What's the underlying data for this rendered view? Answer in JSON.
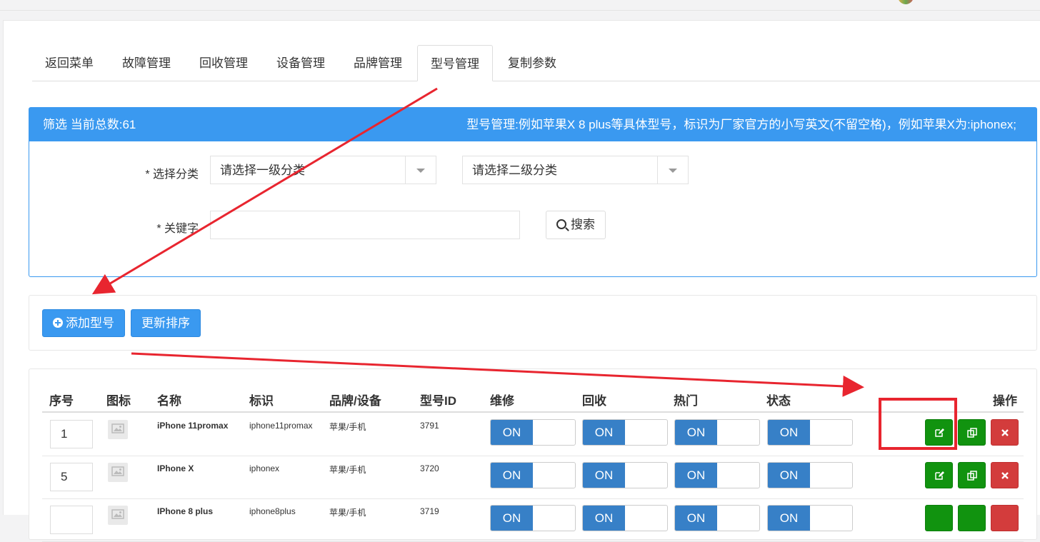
{
  "tabs": [
    {
      "label": "返回菜单"
    },
    {
      "label": "故障管理"
    },
    {
      "label": "回收管理"
    },
    {
      "label": "设备管理"
    },
    {
      "label": "品牌管理"
    },
    {
      "label": "型号管理"
    },
    {
      "label": "复制参数"
    }
  ],
  "active_tab": "型号管理",
  "filter": {
    "title": "筛选 当前总数:61",
    "hint": "型号管理:例如苹果X 8 plus等具体型号，标识为厂家官方的小写英文(不留空格)，例如苹果X为:iphonex;",
    "category_label": "* 选择分类",
    "category1_value": "请选择一级分类",
    "category2_value": "请选择二级分类",
    "keyword_label": "* 关键字",
    "keyword_value": "",
    "search_label": "搜索"
  },
  "actions": {
    "add_label": "添加型号",
    "sort_label": "更新排序"
  },
  "table": {
    "headers": {
      "sort": "序号",
      "icon": "图标",
      "name": "名称",
      "slug": "标识",
      "brand": "品牌/设备",
      "model_id": "型号ID",
      "repair": "维修",
      "recycle": "回收",
      "hot": "热门",
      "status": "状态",
      "ops": "操作"
    },
    "rows": [
      {
        "sort": "1",
        "name": "iPhone 11promax",
        "slug": "iphone11promax",
        "brand": "苹果/手机",
        "model_id": "3791",
        "repair": "ON",
        "recycle": "ON",
        "hot": "ON",
        "status": "ON"
      },
      {
        "sort": "5",
        "name": "IPhone X",
        "slug": "iphonex",
        "brand": "苹果/手机",
        "model_id": "3720",
        "repair": "ON",
        "recycle": "ON",
        "hot": "ON",
        "status": "ON"
      },
      {
        "sort": "",
        "name": "IPhone 8 plus",
        "slug": "iphone8plus",
        "brand": "苹果/手机",
        "model_id": "3719",
        "repair": "ON",
        "recycle": "ON",
        "hot": "ON",
        "status": "ON"
      }
    ]
  },
  "colors": {
    "primary": "#3a99f0",
    "switch_on": "#3780c7",
    "edit_green": "#11930f",
    "delete_red": "#d33c3c",
    "annotation_red": "#e8252f"
  },
  "icons": {
    "search": "search-icon",
    "add": "plus-circle-icon",
    "edit": "edit-icon",
    "copy": "copy-icon",
    "delete": "close-icon",
    "thumbnail": "image-placeholder-icon"
  }
}
